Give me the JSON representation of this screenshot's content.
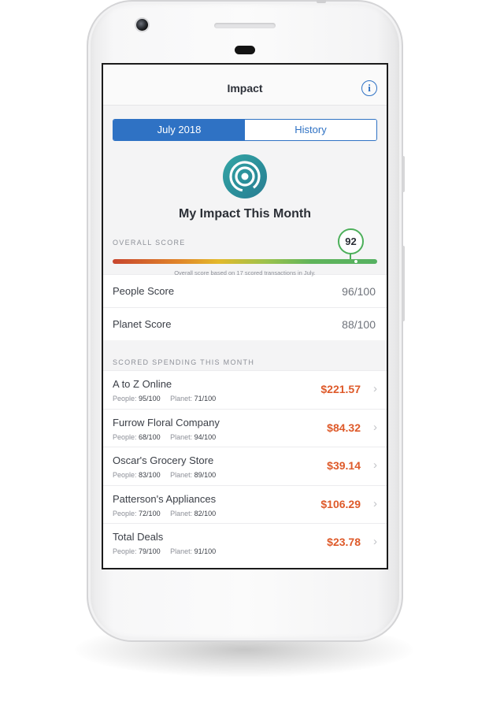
{
  "nav": {
    "title": "Impact",
    "info_icon": "info-icon"
  },
  "tabs": [
    {
      "label": "July 2018",
      "selected": true
    },
    {
      "label": "History",
      "selected": false
    }
  ],
  "impact": {
    "logo_icon": "concentric-circles-icon",
    "title": "My Impact This Month"
  },
  "overall": {
    "label": "OVERALL SCORE",
    "score": "92",
    "score_fraction": 0.92,
    "note": "Overall score based on 17 scored transactions in July."
  },
  "scores": [
    {
      "label": "People Score",
      "value": "96/100"
    },
    {
      "label": "Planet Score",
      "value": "88/100"
    }
  ],
  "spending": {
    "label": "SCORED SPENDING THIS MONTH",
    "people_prefix": "People:",
    "planet_prefix": "Planet:",
    "items": [
      {
        "merchant": "A to Z Online",
        "people": "95/100",
        "planet": "71/100",
        "amount": "$221.57"
      },
      {
        "merchant": "Furrow Floral Company",
        "people": "68/100",
        "planet": "94/100",
        "amount": "$84.32"
      },
      {
        "merchant": "Oscar's Grocery Store",
        "people": "83/100",
        "planet": "89/100",
        "amount": "$39.14"
      },
      {
        "merchant": "Patterson's Appliances",
        "people": "72/100",
        "planet": "82/100",
        "amount": "$106.29"
      },
      {
        "merchant": "Total Deals",
        "people": "79/100",
        "planet": "91/100",
        "amount": "$23.78"
      }
    ]
  },
  "colors": {
    "accent": "#2f72c4",
    "amount": "#de5a2a",
    "score_good": "#4caf5a",
    "logo": "#2b8f9a"
  }
}
